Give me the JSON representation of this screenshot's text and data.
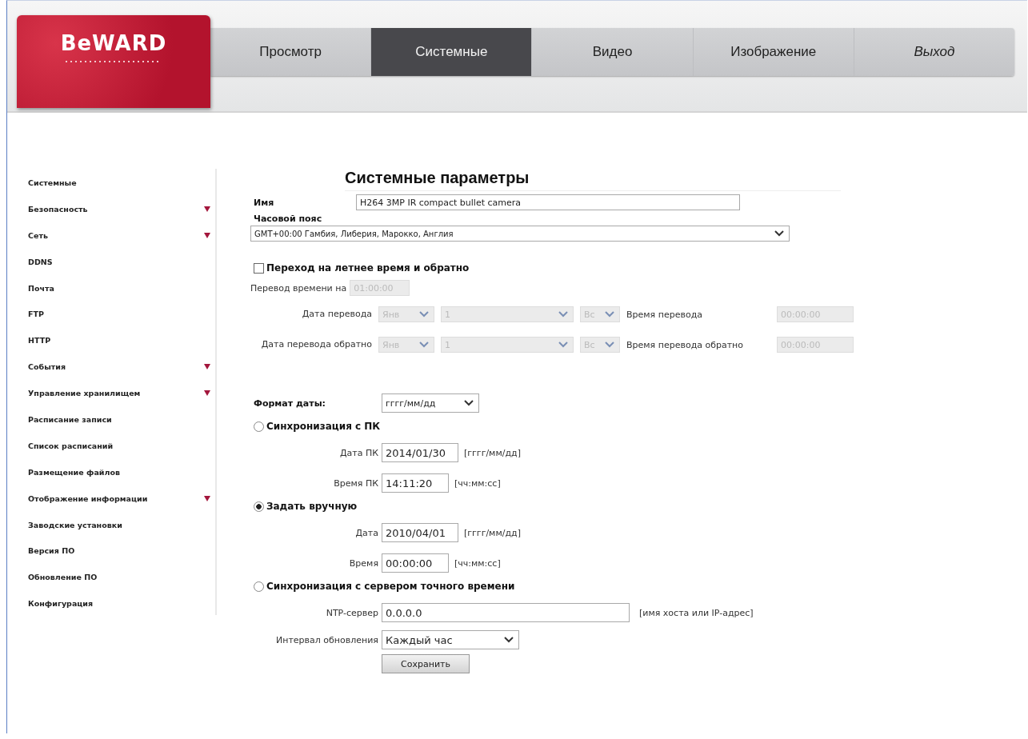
{
  "logo": {
    "brand": "BeWARD"
  },
  "tabs": [
    {
      "label": "Просмотр",
      "selected": false,
      "kind": "page"
    },
    {
      "label": "Системные",
      "selected": true,
      "kind": "page"
    },
    {
      "label": "Видео",
      "selected": false,
      "kind": "page"
    },
    {
      "label": "Изображение",
      "selected": false,
      "kind": "page"
    },
    {
      "label": "Выход",
      "selected": false,
      "kind": "exit"
    }
  ],
  "sidebar": {
    "items": [
      {
        "label": "Системные",
        "submenu": false
      },
      {
        "label": "Безопасность",
        "submenu": true
      },
      {
        "label": "Сеть",
        "submenu": true
      },
      {
        "label": "DDNS",
        "submenu": false
      },
      {
        "label": "Почта",
        "submenu": false
      },
      {
        "label": "FTP",
        "submenu": false
      },
      {
        "label": "HTTP",
        "submenu": false
      },
      {
        "label": "События",
        "submenu": true
      },
      {
        "label": "Управление хранилищем",
        "submenu": true
      },
      {
        "label": "Расписание записи",
        "submenu": false
      },
      {
        "label": "Список расписаний",
        "submenu": false
      },
      {
        "label": "Размещение файлов",
        "submenu": false
      },
      {
        "label": "Отображение информации",
        "submenu": true
      },
      {
        "label": "Заводские установки",
        "submenu": false
      },
      {
        "label": "Версия ПО",
        "submenu": false
      },
      {
        "label": "Обновление ПО",
        "submenu": false
      },
      {
        "label": "Конфигурация",
        "submenu": false
      }
    ]
  },
  "form": {
    "title": "Системные параметры",
    "name": {
      "label": "Имя",
      "value": "H264 3MP IR compact bullet camera"
    },
    "timezone": {
      "label": "Часовой пояс",
      "value": "GMT+00:00 Гамбия, Либерия, Марокко, Англия"
    },
    "dst": {
      "label": "Переход на летнее время и обратно",
      "checked": false
    },
    "dst_settings": {
      "disabled": true,
      "shift": {
        "label": "Перевод времени на",
        "value": "01:00:00"
      },
      "transitions": [
        {
          "label": "Дата перевода",
          "month": "Янв",
          "day": "1",
          "weekday": "Вс",
          "time_label": "Время перевода",
          "time": "00:00:00"
        },
        {
          "label": "Дата перевода обратно",
          "month": "Янв",
          "day": "1",
          "weekday": "Вс",
          "time_label": "Время перевода обратно",
          "time": "00:00:00"
        }
      ]
    },
    "date_format": {
      "label": "Формат даты:",
      "value": "гггг/мм/дд"
    },
    "sync_modes": [
      {
        "label": "Синхронизация с ПК",
        "selected": false,
        "fields": [
          {
            "label": "Дата ПК",
            "value": "2014/01/30",
            "hint": "[гггг/мм/дд]",
            "kind": "short"
          },
          {
            "label": "Время ПК",
            "value": "14:11:20",
            "hint": "[чч:мм:сс]",
            "kind": "time"
          }
        ]
      },
      {
        "label": "Задать вручную",
        "selected": true,
        "fields": [
          {
            "label": "Дата",
            "value": "2010/04/01",
            "hint": "[гггг/мм/дд]",
            "kind": "short"
          },
          {
            "label": "Время",
            "value": "00:00:00",
            "hint": "[чч:мм:сс]",
            "kind": "time"
          }
        ]
      },
      {
        "label": "Синхронизация с сервером точного времени",
        "selected": false,
        "fields": [
          {
            "label": "NTP-сервер",
            "value": "0.0.0.0",
            "hint": "[имя хоста или IP-адрес]",
            "kind": "wide"
          }
        ]
      }
    ],
    "interval": {
      "label": "Интервал обновления",
      "value": "Каждый час"
    },
    "save": "Сохранить"
  }
}
